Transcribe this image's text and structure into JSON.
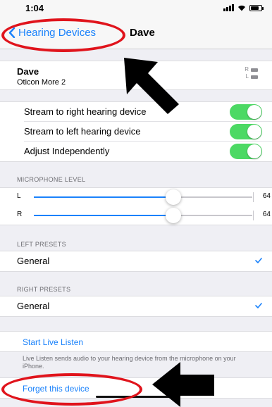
{
  "status_bar": {
    "time": "1:04"
  },
  "nav": {
    "back_label": "Hearing Devices",
    "title": "Dave"
  },
  "device": {
    "name": "Dave",
    "model": "Oticon More 2",
    "right_label": "R",
    "left_label": "L"
  },
  "streaming": [
    {
      "label": "Stream to right hearing device",
      "on": true
    },
    {
      "label": "Stream to left hearing device",
      "on": true
    },
    {
      "label": "Adjust Independently",
      "on": true
    }
  ],
  "microphone": {
    "header": "MICROPHONE LEVEL",
    "left": {
      "side": "L",
      "value": "64",
      "level_percent": 64
    },
    "right": {
      "side": "R",
      "value": "64",
      "level_percent": 64
    }
  },
  "left_presets": {
    "header": "LEFT PRESETS",
    "selected": "General"
  },
  "right_presets": {
    "header": "RIGHT PRESETS",
    "selected": "General"
  },
  "live_listen": {
    "label": "Start Live Listen",
    "note": "Live Listen sends audio to your hearing device from the microphone on your iPhone."
  },
  "forget": {
    "label": "Forget this device"
  },
  "colors": {
    "accent": "#1a82fb",
    "toggle_on": "#4cd964",
    "annotation": "#e0141c"
  }
}
